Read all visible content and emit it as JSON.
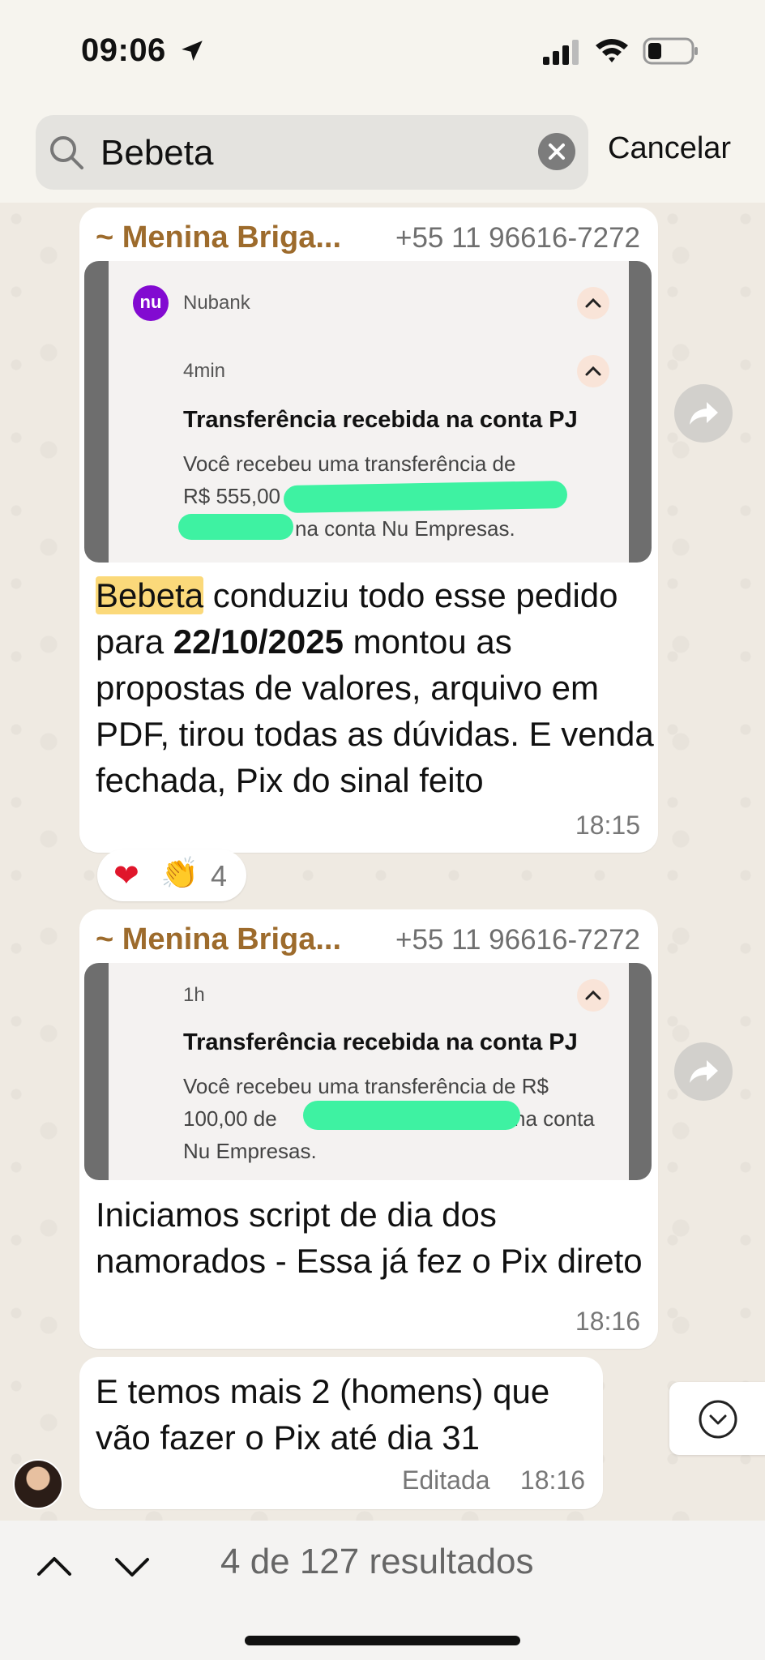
{
  "status_bar": {
    "time": "09:06",
    "icons": [
      "location-arrow-icon",
      "cellular-signal-icon",
      "wifi-icon",
      "battery-icon"
    ]
  },
  "search": {
    "value": "Bebeta",
    "cancel_label": "Cancelar"
  },
  "messages": [
    {
      "sender": "~ Menina Briga...",
      "phone": "+55 11 96616-7272",
      "attachment": {
        "app_name": "Nubank",
        "app_logo_text": "nu",
        "age": "4min",
        "title": "Transferência recebida na conta PJ",
        "body_line1": "Você recebeu uma transferência de",
        "body_line2_prefix": "R$ 555,00 de",
        "body_line3_suffix": "na conta Nu Empresas."
      },
      "text_highlight": "Bebeta",
      "text_part1": " conduziu todo esse pedido para ",
      "text_bold": "22/10/2025",
      "text_part2": " montou as propostas de valores, arquivo em PDF, tirou todas as dúvidas. E venda fechada, Pix do sinal feito",
      "time": "18:15",
      "reactions": {
        "count": "4"
      }
    },
    {
      "sender": "~ Menina Briga...",
      "phone": "+55 11 96616-7272",
      "attachment": {
        "age": "1h",
        "title": "Transferência recebida na conta PJ",
        "body_line1": "Você recebeu uma transferência de R$",
        "body_line2_prefix": "100,00 de",
        "body_line2_suffix": "na conta",
        "body_line3": "Nu Empresas."
      },
      "text": "Iniciamos script de dia dos namorados - Essa já fez o Pix direto",
      "time": "18:16"
    },
    {
      "text": "E temos mais 2 (homens) que vão fazer o Pix até dia 31",
      "edited_label": "Editada",
      "time": "18:16"
    }
  ],
  "results_nav": {
    "count_text": "4 de 127 resultados"
  },
  "colors": {
    "sender_name": "#9d6b2c",
    "highlight": "#fbd97a",
    "redaction": "#3ef2a2",
    "nubank_purple": "#820ad1"
  }
}
